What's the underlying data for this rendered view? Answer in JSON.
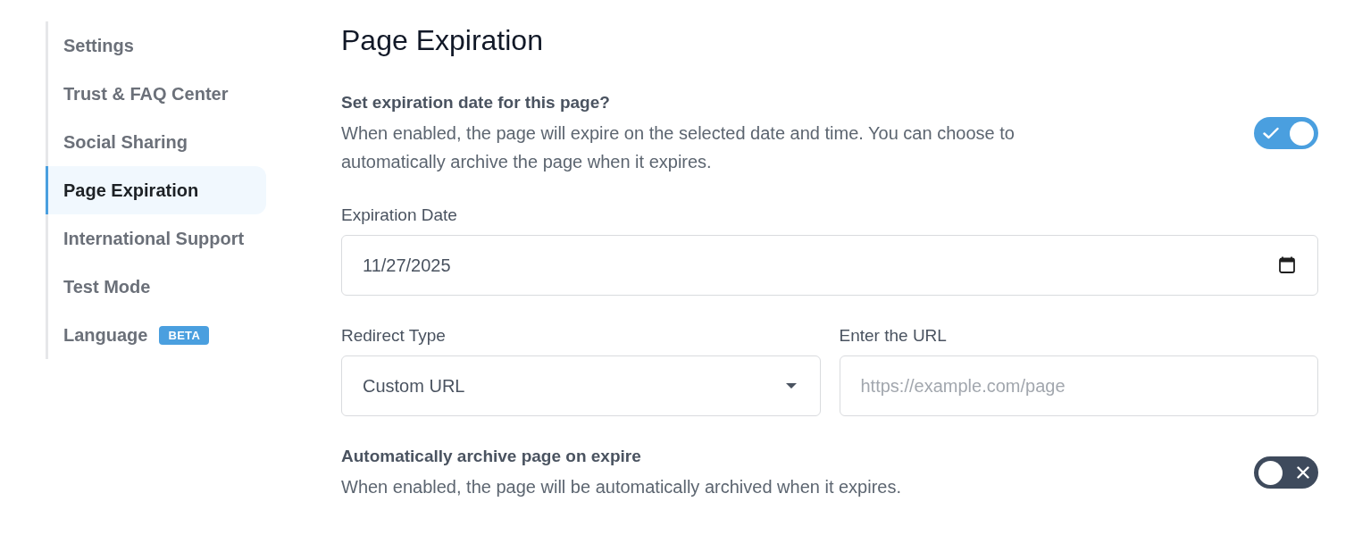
{
  "sidebar": {
    "items": [
      {
        "label": "Settings",
        "selected": false
      },
      {
        "label": "Trust & FAQ Center",
        "selected": false
      },
      {
        "label": "Social Sharing",
        "selected": false
      },
      {
        "label": "Page Expiration",
        "selected": true
      },
      {
        "label": "International Support",
        "selected": false
      },
      {
        "label": "Test Mode",
        "selected": false
      },
      {
        "label": "Language",
        "selected": false,
        "badge": "BETA"
      }
    ]
  },
  "main": {
    "title": "Page Expiration",
    "expiration_toggle": {
      "label": "Set expiration date for this page?",
      "description": "When enabled, the page will expire on the selected date and time. You can choose to automatically archive the page when it expires.",
      "on": true
    },
    "expiration_date": {
      "label": "Expiration Date",
      "value": "11/27/2025"
    },
    "redirect_type": {
      "label": "Redirect Type",
      "value": "Custom URL"
    },
    "redirect_url": {
      "label": "Enter the URL",
      "placeholder": "https://example.com/page"
    },
    "archive_toggle": {
      "label": "Automatically archive page on expire",
      "description": "When enabled, the page will be automatically archived when it expires.",
      "on": false
    }
  }
}
